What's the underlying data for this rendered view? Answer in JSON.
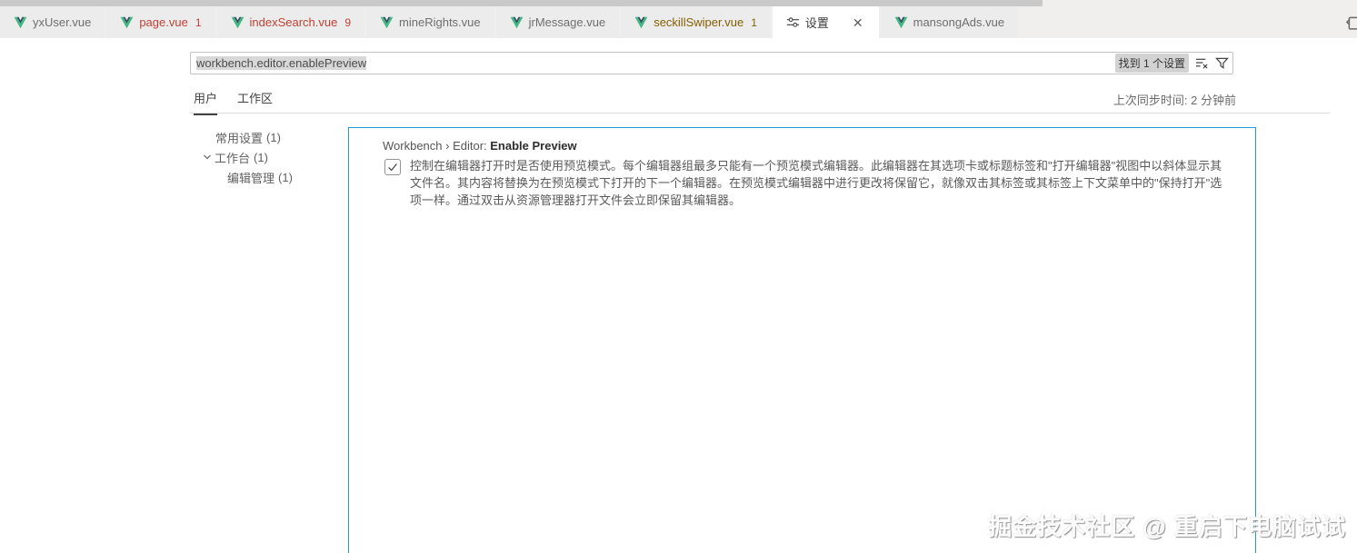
{
  "tab_bar": {
    "tabs": [
      {
        "label": "yxUser.vue",
        "badge": "",
        "state": "normal"
      },
      {
        "label": "page.vue",
        "badge": "1",
        "state": "error"
      },
      {
        "label": "indexSearch.vue",
        "badge": "9",
        "state": "error"
      },
      {
        "label": "mineRights.vue",
        "badge": "",
        "state": "normal"
      },
      {
        "label": "jrMessage.vue",
        "badge": "",
        "state": "normal"
      },
      {
        "label": "seckillSwiper.vue",
        "badge": "1",
        "state": "warning"
      },
      {
        "label": "设置",
        "badge": "",
        "state": "active",
        "icon": "settings-sliders-icon",
        "close": "✕"
      },
      {
        "label": "mansongAds.vue",
        "badge": "",
        "state": "normal"
      }
    ]
  },
  "search": {
    "value": "workbench.editor.enablePreview",
    "result_badge": "找到 1 个设置",
    "icons": [
      "clear-filter-icon",
      "filter-icon"
    ]
  },
  "scope_tabs": {
    "user": "用户",
    "workspace": "工作区",
    "sync_status": "上次同步时间: 2 分钟前"
  },
  "toc": {
    "items": [
      {
        "label": "常用设置",
        "count": "(1)"
      },
      {
        "label": "工作台",
        "count": "(1)"
      },
      {
        "label": "编辑管理",
        "count": "(1)"
      }
    ]
  },
  "setting": {
    "title_prefix": "Workbench › Editor: ",
    "title_bold": "Enable Preview",
    "checked": true,
    "description": "控制在编辑器打开时是否使用预览模式。每个编辑器组最多只能有一个预览模式编辑器。此编辑器在其选项卡或标题标签和\"打开编辑器\"视图中以斜体显示其文件名。其内容将替换为在预览模式下打开的下一个编辑器。在预览模式编辑器中进行更改将保留它，就像双击其标签或其标签上下文菜单中的\"保持打开\"选项一样。通过双击从资源管理器打开文件会立即保留其编辑器。"
  },
  "watermark": "掘金技术社区 @ 重启下电脑试试",
  "colors": {
    "panel_border": "#1f9ad7",
    "tab_error": "#bf4136",
    "tab_warning": "#855f00",
    "vue_green": "#41b883",
    "vue_dark": "#35495e",
    "top_strip": "#c9c9c9",
    "selection_highlight": "#d8d8d8",
    "badge_background": "#d2d2d2"
  }
}
